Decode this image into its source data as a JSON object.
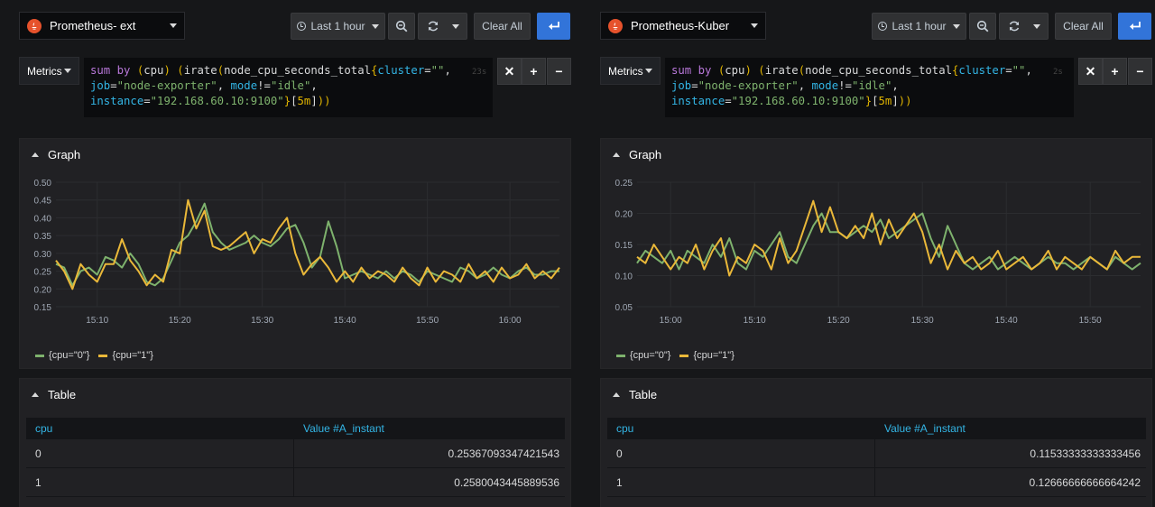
{
  "panes": [
    {
      "datasource": "Prometheus- ext",
      "time_range": "Last 1 hour",
      "clear_all": "Clear All",
      "metrics_label": "Metrics",
      "query": {
        "line1_a": "sum by (cpu) (irate(node_cpu_seconds_total{cluster=\"\",",
        "line2": "job=\"node-exporter\", mode!=\"idle\",",
        "line3": "instance=\"192.168.60.10:9100\"}[5m]))"
      },
      "query_hint": "23s",
      "graph_title": "Graph",
      "table_title": "Table",
      "table": {
        "columns": [
          "cpu",
          "Value #A_instant"
        ],
        "rows": [
          [
            "0",
            "0.25367093347421543"
          ],
          [
            "1",
            "0.2580043445889536"
          ]
        ]
      },
      "chart_data": {
        "type": "line",
        "x_ticks": [
          "15:10",
          "15:20",
          "15:30",
          "15:40",
          "15:50",
          "16:00"
        ],
        "y_ticks": [
          "0.50",
          "0.45",
          "0.40",
          "0.35",
          "0.30",
          "0.25",
          "0.20",
          "0.15"
        ],
        "ylim": [
          0.15,
          0.5
        ],
        "xlim_minutes": [
          5,
          66
        ],
        "series": [
          {
            "name": "{cpu=\"0\"}",
            "color": "#7eb26d",
            "x": [
              5,
              6,
              7,
              8,
              9,
              10,
              11,
              12,
              13,
              14,
              15,
              16,
              17,
              18,
              19,
              20,
              21,
              22,
              23,
              24,
              25,
              26,
              27,
              28,
              29,
              30,
              31,
              32,
              33,
              34,
              35,
              36,
              37,
              38,
              39,
              40,
              41,
              42,
              43,
              44,
              45,
              46,
              47,
              48,
              49,
              50,
              51,
              52,
              53,
              54,
              55,
              56,
              57,
              58,
              59,
              60,
              61,
              62,
              63,
              64,
              65,
              66
            ],
            "y": [
              0.27,
              0.26,
              0.21,
              0.25,
              0.26,
              0.24,
              0.29,
              0.28,
              0.26,
              0.3,
              0.27,
              0.22,
              0.21,
              0.23,
              0.28,
              0.33,
              0.35,
              0.39,
              0.44,
              0.36,
              0.33,
              0.31,
              0.32,
              0.33,
              0.35,
              0.33,
              0.32,
              0.34,
              0.37,
              0.38,
              0.33,
              0.26,
              0.29,
              0.39,
              0.32,
              0.23,
              0.24,
              0.25,
              0.24,
              0.23,
              0.25,
              0.23,
              0.25,
              0.24,
              0.22,
              0.25,
              0.24,
              0.23,
              0.22,
              0.26,
              0.25,
              0.23,
              0.24,
              0.26,
              0.24,
              0.23,
              0.25,
              0.26,
              0.24,
              0.24,
              0.25,
              0.25
            ]
          },
          {
            "name": "{cpu=\"1\"}",
            "color": "#eab839",
            "x": [
              5,
              6,
              7,
              8,
              9,
              10,
              11,
              12,
              13,
              14,
              15,
              16,
              17,
              18,
              19,
              20,
              21,
              22,
              23,
              24,
              25,
              26,
              27,
              28,
              29,
              30,
              31,
              32,
              33,
              34,
              35,
              36,
              37,
              38,
              39,
              40,
              41,
              42,
              43,
              44,
              45,
              46,
              47,
              48,
              49,
              50,
              51,
              52,
              53,
              54,
              55,
              56,
              57,
              58,
              59,
              60,
              61,
              62,
              63,
              64,
              65,
              66
            ],
            "y": [
              0.28,
              0.25,
              0.2,
              0.27,
              0.24,
              0.22,
              0.27,
              0.27,
              0.34,
              0.28,
              0.25,
              0.21,
              0.24,
              0.22,
              0.31,
              0.3,
              0.45,
              0.37,
              0.42,
              0.32,
              0.31,
              0.32,
              0.34,
              0.36,
              0.3,
              0.34,
              0.33,
              0.37,
              0.4,
              0.3,
              0.24,
              0.27,
              0.29,
              0.26,
              0.22,
              0.25,
              0.22,
              0.26,
              0.23,
              0.25,
              0.24,
              0.22,
              0.26,
              0.23,
              0.21,
              0.26,
              0.22,
              0.25,
              0.24,
              0.22,
              0.27,
              0.23,
              0.25,
              0.22,
              0.26,
              0.23,
              0.24,
              0.27,
              0.23,
              0.25,
              0.23,
              0.26
            ]
          }
        ]
      }
    },
    {
      "datasource": "Prometheus-Kuber",
      "time_range": "Last 1 hour",
      "clear_all": "Clear All",
      "metrics_label": "Metrics",
      "query": {
        "line1_a": "sum by (cpu) (irate(node_cpu_seconds_total{cluster=\"\",",
        "line2": "job=\"node-exporter\", mode!=\"idle\",",
        "line3": "instance=\"192.168.60.10:9100\"}[5m]))"
      },
      "query_hint": "2s",
      "graph_title": "Graph",
      "table_title": "Table",
      "table": {
        "columns": [
          "cpu",
          "Value #A_instant"
        ],
        "rows": [
          [
            "0",
            "0.11533333333333456"
          ],
          [
            "1",
            "0.12666666666664242"
          ]
        ]
      },
      "chart_data": {
        "type": "line",
        "x_ticks": [
          "15:00",
          "15:10",
          "15:20",
          "15:30",
          "15:40",
          "15:50"
        ],
        "y_ticks": [
          "0.25",
          "0.20",
          "0.15",
          "0.10",
          "0.05"
        ],
        "ylim": [
          0.05,
          0.25
        ],
        "xlim_minutes": [
          -4,
          56
        ],
        "series": [
          {
            "name": "{cpu=\"0\"}",
            "color": "#7eb26d",
            "x": [
              -4,
              -3,
              -2,
              -1,
              0,
              1,
              2,
              3,
              4,
              5,
              6,
              7,
              8,
              9,
              10,
              11,
              12,
              13,
              14,
              15,
              16,
              17,
              18,
              19,
              20,
              21,
              22,
              23,
              24,
              25,
              26,
              27,
              28,
              29,
              30,
              31,
              32,
              33,
              34,
              35,
              36,
              37,
              38,
              39,
              40,
              41,
              42,
              43,
              44,
              45,
              46,
              47,
              48,
              49,
              50,
              51,
              52,
              53,
              54,
              55,
              56
            ],
            "y": [
              0.12,
              0.14,
              0.13,
              0.12,
              0.14,
              0.11,
              0.14,
              0.13,
              0.12,
              0.15,
              0.13,
              0.16,
              0.12,
              0.11,
              0.14,
              0.13,
              0.15,
              0.17,
              0.13,
              0.12,
              0.15,
              0.18,
              0.2,
              0.17,
              0.17,
              0.16,
              0.17,
              0.18,
              0.17,
              0.19,
              0.16,
              0.17,
              0.18,
              0.19,
              0.2,
              0.16,
              0.13,
              0.18,
              0.15,
              0.12,
              0.11,
              0.12,
              0.13,
              0.11,
              0.12,
              0.13,
              0.12,
              0.11,
              0.12,
              0.13,
              0.12,
              0.12,
              0.11,
              0.12,
              0.13,
              0.12,
              0.11,
              0.13,
              0.12,
              0.11,
              0.12
            ]
          },
          {
            "name": "{cpu=\"1\"}",
            "color": "#eab839",
            "x": [
              -4,
              -3,
              -2,
              -1,
              0,
              1,
              2,
              3,
              4,
              5,
              6,
              7,
              8,
              9,
              10,
              11,
              12,
              13,
              14,
              15,
              16,
              17,
              18,
              19,
              20,
              21,
              22,
              23,
              24,
              25,
              26,
              27,
              28,
              29,
              30,
              31,
              32,
              33,
              34,
              35,
              36,
              37,
              38,
              39,
              40,
              41,
              42,
              43,
              44,
              45,
              46,
              47,
              48,
              49,
              50,
              51,
              52,
              53,
              54,
              55,
              56
            ],
            "y": [
              0.13,
              0.12,
              0.15,
              0.13,
              0.11,
              0.13,
              0.12,
              0.15,
              0.11,
              0.14,
              0.16,
              0.1,
              0.13,
              0.12,
              0.15,
              0.14,
              0.11,
              0.16,
              0.12,
              0.14,
              0.18,
              0.22,
              0.17,
              0.21,
              0.17,
              0.16,
              0.18,
              0.16,
              0.2,
              0.15,
              0.19,
              0.16,
              0.18,
              0.2,
              0.17,
              0.12,
              0.15,
              0.11,
              0.14,
              0.12,
              0.13,
              0.11,
              0.12,
              0.14,
              0.11,
              0.12,
              0.13,
              0.11,
              0.12,
              0.14,
              0.11,
              0.13,
              0.12,
              0.11,
              0.13,
              0.12,
              0.11,
              0.14,
              0.12,
              0.13,
              0.13
            ]
          }
        ]
      }
    }
  ]
}
